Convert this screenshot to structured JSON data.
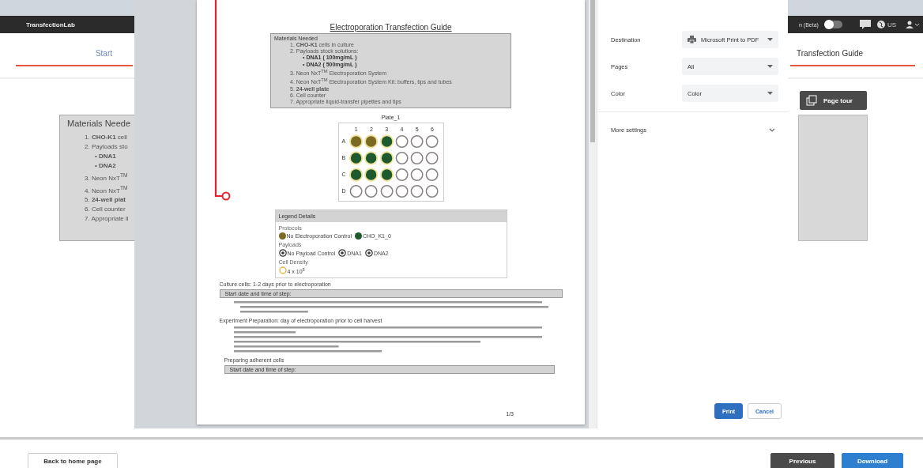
{
  "app": {
    "brand": "TransfectionLab",
    "beta_label": "n (Beta)",
    "beta_toggle_on": false,
    "language": "US"
  },
  "tabs": [
    {
      "label": "Start",
      "completed": true
    },
    {
      "label": "Transfection Guide",
      "completed": true
    }
  ],
  "page_tour_button": "Page tour",
  "materials": {
    "title": "Materials Neede",
    "items": [
      "1. **CHO-K1** cell",
      "2. Payloads sto",
      "• **DNA1**",
      "• **DNA2**",
      "3. Neon NxT$^{TM}$",
      "4. Neon NxT$^{TM}$",
      "5. **24-well plat**",
      "6. Cell counter",
      "7. Appropriate li"
    ]
  },
  "print_dialog": {
    "document": {
      "title": "Electroporation Transfection Guide",
      "materials": {
        "title": "Materials Needed",
        "items": [
          {
            "text": "1. **CHO-K1** cells in culture",
            "sub": false
          },
          {
            "text": "2. Payloads stock solutions:",
            "sub": false
          },
          {
            "text": "• **DNA1 ( 100mg/mL )**",
            "sub": true
          },
          {
            "text": "• **DNA2 ( 500mg/mL )**",
            "sub": true
          },
          {
            "text": "3. Neon NxT$^{TM}$ Electroporation System",
            "sub": false
          },
          {
            "text": "4. Neon NxT$^{TM}$ Electroporation System Kit: buffers, tips and tubes",
            "sub": false
          },
          {
            "text": "5. **24-well plate**",
            "sub": false
          },
          {
            "text": "6. Cell counter",
            "sub": false
          },
          {
            "text": "7. Appropriate liquid-transfer pipettes and tips",
            "sub": false
          }
        ]
      },
      "plate": {
        "title": "Plate_1",
        "columns": [
          "1",
          "2",
          "3",
          "4",
          "5",
          "6"
        ],
        "rows": [
          {
            "label": "A",
            "wells": [
              {
                "color": "#7a6a22"
              },
              {
                "color": "#7a6a22"
              },
              {
                "color": "#1f5a2c"
              },
              {
                "filled": false
              },
              {
                "filled": false
              },
              {
                "filled": false
              }
            ]
          },
          {
            "label": "B",
            "wells": [
              {
                "color": "#1f5a2c"
              },
              {
                "color": "#1f5a2c"
              },
              {
                "color": "#1f5a2c"
              },
              {
                "filled": false
              },
              {
                "filled": false
              },
              {
                "filled": false
              }
            ]
          },
          {
            "label": "C",
            "wells": [
              {
                "color": "#1f5a2c"
              },
              {
                "color": "#1f5a2c"
              },
              {
                "color": "#1f5a2c"
              },
              {
                "filled": false
              },
              {
                "filled": false
              },
              {
                "filled": false
              }
            ]
          },
          {
            "label": "D",
            "wells": [
              {
                "filled": false
              },
              {
                "filled": false
              },
              {
                "filled": false
              },
              {
                "filled": false
              },
              {
                "filled": false
              },
              {
                "filled": false
              }
            ]
          }
        ]
      },
      "legend": {
        "title": "Legend Details",
        "protocols_label": "Protocols",
        "protocols": [
          {
            "label": "No Electroporation Control",
            "color": "#7a6a22"
          },
          {
            "label": "CHO_K1_0",
            "color": "#1f5a2c"
          }
        ],
        "payloads_label": "Payloads",
        "payloads": [
          "No Payload Control",
          "DNA1",
          "DNA2"
        ],
        "density_label": "Cell Density",
        "densities": [
          "4 x 10$^{5}$"
        ]
      },
      "sections": [
        {
          "title": "Culture cells: 1-2 days prior to electroporation",
          "indent": false,
          "step_field": "Start date and time of step:",
          "kind": "paragraph"
        },
        {
          "title": "Experiment Preparation: day of electroporation prior to cell harvest",
          "indent": false,
          "kind": "list"
        },
        {
          "title": "Preparing adherent cells",
          "indent": true,
          "step_field": "Start date and time of step:"
        }
      ],
      "page_number": "1/3"
    },
    "settings": [
      {
        "label": "Destination",
        "value": "Microsoft Print to PDF",
        "kind": "printer"
      },
      {
        "label": "Pages",
        "value": "All",
        "kind": "select"
      },
      {
        "label": "Color",
        "value": "Color",
        "kind": "select"
      }
    ],
    "more_settings": "More settings",
    "buttons": [
      {
        "label": "Print",
        "kind": "primary"
      },
      {
        "label": "Cancel",
        "kind": "secondary"
      }
    ]
  },
  "footer": {
    "back": "Back to home page",
    "buttons": [
      {
        "label": "Previous",
        "kind": "dark"
      },
      {
        "label": "Download",
        "kind": "primary"
      }
    ]
  }
}
